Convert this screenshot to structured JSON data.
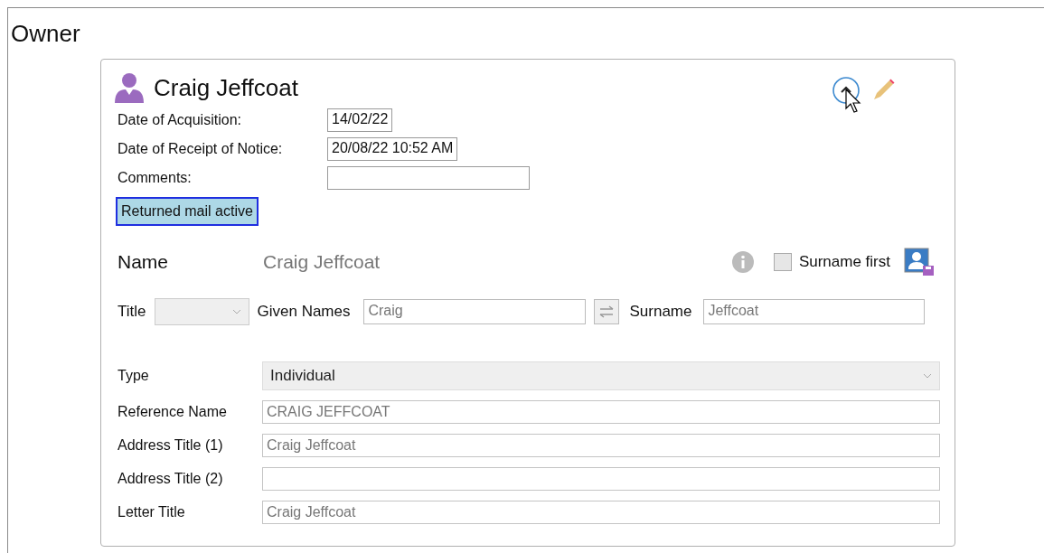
{
  "section_title": "Owner",
  "owner": {
    "name": "Craig Jeffcoat",
    "details": [
      {
        "label": "Date of Acquisition:",
        "value": "14/02/22"
      },
      {
        "label": "Date of Receipt of Notice:",
        "value": "20/08/22 10:52 AM"
      },
      {
        "label": "Comments:"
      }
    ],
    "badge": "Returned mail active"
  },
  "name_section": {
    "heading": "Name",
    "display_name": "Craig Jeffcoat",
    "surname_first": {
      "label": "Surname first",
      "checked": false
    },
    "title_label": "Title",
    "given_label": "Given Names",
    "given": "Craig",
    "surname_label": "Surname",
    "surname": "Jeffcoat",
    "disabled": true
  },
  "fields": [
    {
      "kind": "select",
      "label": "Type",
      "value": "Individual",
      "disabled": false
    },
    {
      "kind": "text",
      "label": "Reference Name",
      "value": "CRAIG JEFFCOAT",
      "disabled": true
    },
    {
      "kind": "text",
      "label": "Address Title (1)",
      "value": "Craig Jeffcoat",
      "disabled": true
    },
    {
      "kind": "text",
      "label": "Address Title (2)",
      "disabled": true
    },
    {
      "kind": "text",
      "label": "Letter Title",
      "value": "Craig Jeffcoat",
      "disabled": true
    }
  ]
}
